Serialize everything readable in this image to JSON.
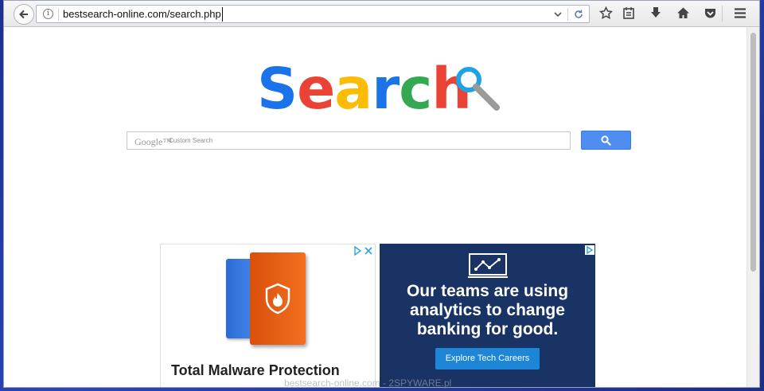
{
  "toolbar": {
    "url": "bestsearch-online.com/search.php",
    "icons": [
      "back-arrow-icon",
      "info-icon",
      "dropdown-icon",
      "reload-icon",
      "star-icon",
      "reading-list-icon",
      "download-icon",
      "home-icon",
      "pocket-icon",
      "menu-icon"
    ]
  },
  "logo": {
    "letters": [
      "S",
      "e",
      "a",
      "r",
      "c",
      "h"
    ],
    "colors": [
      "#1a73e8",
      "#ea4335",
      "#fbbc05",
      "#1a73e8",
      "#34a853",
      "#ea4335"
    ]
  },
  "search": {
    "google_label": "Google™",
    "placeholder": "Custom Search",
    "button_icon": "search-icon"
  },
  "ads": {
    "left": {
      "title": "Total Malware Protection"
    },
    "right": {
      "headline_lines": [
        "Our teams are using",
        "analytics to change",
        "banking for good."
      ],
      "cta": "Explore Tech Careers"
    }
  },
  "watermark": "bestsearch-online.com - 2SPYWARE.pl",
  "colors": {
    "accent": "#4d8ef0",
    "ad_navy": "#183364",
    "ad_button": "#1e86d6"
  }
}
